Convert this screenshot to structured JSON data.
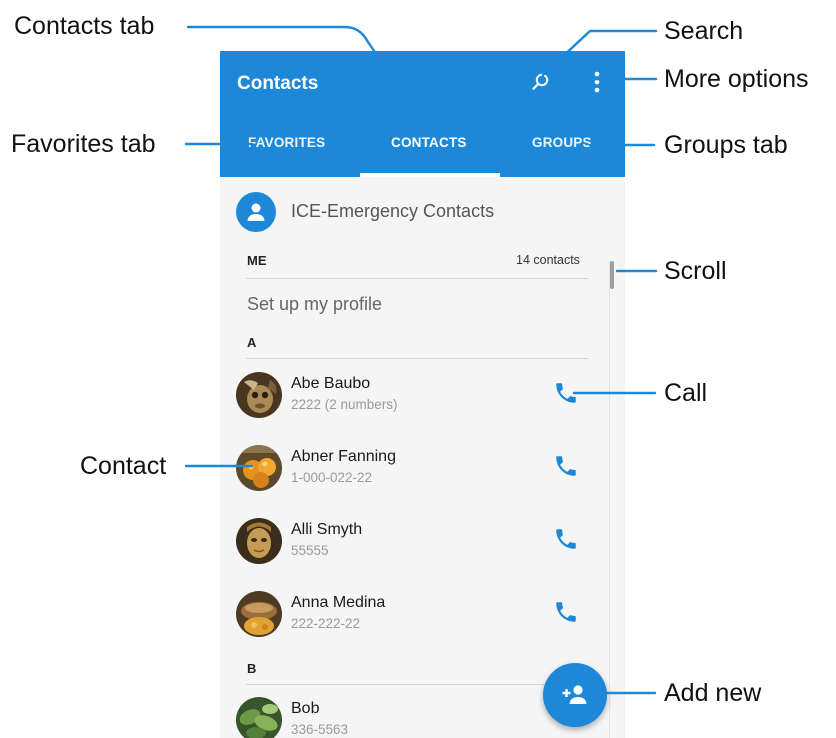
{
  "app": {
    "title": "Contacts"
  },
  "tabs": [
    {
      "label": "FAVORITES",
      "selected": false
    },
    {
      "label": "CONTACTS",
      "selected": true
    },
    {
      "label": "GROUPS",
      "selected": false
    }
  ],
  "toolbar": {
    "search_icon": "search-icon",
    "more_icon": "more-vertical-icon"
  },
  "ice": {
    "label": "ICE-Emergency Contacts",
    "icon": "person-icon"
  },
  "me_section": {
    "header": "ME",
    "count": "14 contacts",
    "profile_prompt": "Set up my profile"
  },
  "sections": [
    {
      "letter": "A",
      "contacts": [
        {
          "name": "Abe Baubo",
          "number": "2222 (2 numbers)"
        },
        {
          "name": "Abner Fanning",
          "number": "1-000-022-22"
        },
        {
          "name": "Alli Smyth",
          "number": "55555"
        },
        {
          "name": "Anna Medina",
          "number": "222-222-22"
        }
      ]
    },
    {
      "letter": "B",
      "contacts": [
        {
          "name": "Bob",
          "number": "336-5563"
        }
      ]
    }
  ],
  "fab": {
    "icon": "add-person-icon"
  },
  "callouts": {
    "contacts_tab": "Contacts tab",
    "search": "Search",
    "more_options": "More options",
    "favorites_tab": "Favorites tab",
    "groups_tab": "Groups tab",
    "scroll": "Scroll",
    "call": "Call",
    "contact": "Contact",
    "add_new": "Add new"
  },
  "colors": {
    "accent": "#1e88d8",
    "background": "#f5f5f5",
    "callout_line": "#1e88d8"
  }
}
